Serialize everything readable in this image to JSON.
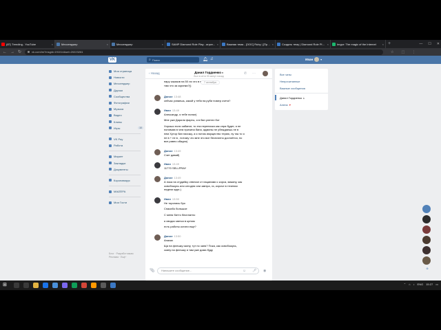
{
  "browser": {
    "tabs": [
      {
        "label": "(87) Trending - YouTube",
        "color": "#ff0000"
      },
      {
        "label": "Мессенджер",
        "color": "#4a76a8",
        "active": true
      },
      {
        "label": "Мессенджер",
        "color": "#4a76a8"
      },
      {
        "label": "SAMP Diamond Role Play - играт...",
        "color": "#3b78c4"
      },
      {
        "label": "Важная тема - [OOC] Ruby | [Про...",
        "color": "#3b78c4"
      },
      {
        "label": "Создать тему | Diamond Role Play...",
        "color": "#3b78c4"
      },
      {
        "label": "Imgur: The magic of the Internet",
        "color": "#1bb76e"
      }
    ],
    "new_tab": "+",
    "close_glyph": "×",
    "url": "vk.com/im?msgid=191014&sel=20223261"
  },
  "vk": {
    "logo": "VK",
    "search_placeholder": "Поиск",
    "user_name": "Иван",
    "menu": [
      {
        "label": "Моя страница"
      },
      {
        "label": "Новости"
      },
      {
        "label": "Мессенджер"
      },
      {
        "label": "Друзья"
      },
      {
        "label": "Сообщества"
      },
      {
        "label": "Фотографии"
      },
      {
        "label": "Музыка"
      },
      {
        "label": "Видео"
      },
      {
        "label": "Клипы"
      },
      {
        "label": "Игры",
        "count": "10"
      }
    ],
    "menu2": [
      {
        "label": "VK Pay"
      },
      {
        "label": "Работа"
      }
    ],
    "menu3": [
      {
        "label": "Маркет"
      },
      {
        "label": "Закладки"
      },
      {
        "label": "Документы"
      }
    ],
    "menu4": [
      {
        "label": "Коронавирус"
      }
    ],
    "menu5": [
      {
        "label": "MAIZEPA"
      }
    ],
    "menu6": [
      {
        "label": "Мои Гости"
      }
    ],
    "footer": [
      "Блог · Разработчикам",
      "Реклама · Ещё ·"
    ]
  },
  "chat": {
    "back_label": "Назад",
    "peer_name": "Данил Гордиенко",
    "peer_status": "был в сети 30 минут назад",
    "date_pill": "7 сентября",
    "top_lines": [
      "пару заказов на 50 ли что в все",
      "там что за скрипки?))"
    ],
    "messages": [
      {
        "author": "Данил",
        "time": "13:48",
        "lines": [
          "сейчас узнаешь, какой у тебя на руби номер счета?"
        ],
        "avatar_color": "#6f5e55"
      },
      {
        "author": "Иван",
        "time": "13:49",
        "lines": [
          "Александр, я тебе понял)",
          "",
          "Мне уже Дарили фарты, я в бан улетел бот",
          "",
          "Хорошо если забанят, то эта переписка как спра будет, я не",
          "понимаю в чем причина бана, админы не убеждаешь не в",
          "нем Хутор бан нахожу, а я потом имущество теряю, ну так то я",
          "не в + не в , потому что мне это все бесплатно достаётся, но",
          "все равно обидно)"
        ],
        "avatar_color": "#3b3a3f"
      },
      {
        "author": "Данил",
        "time": "13:49",
        "lines": [
          "Счет давай)"
        ],
        "avatar_color": "#6f5e55"
      },
      {
        "author": "Иван",
        "time": "13:49",
        "lines": [
          "11770 SELLPRAY"
        ],
        "avatar_color": "#3b3a3f"
      },
      {
        "author": "Данил",
        "time": "13:49",
        "lines": [
          "А пока на студийку отвехал от пацанами с корса, макину, как",
          "освобожусь или сегодня или завтра, хз, короче в течении",
          "недели ждю )"
        ],
        "avatar_color": "#6f5e55"
      },
      {
        "author": "Иван",
        "time": "13:50",
        "lines": [
          "Не торопись бро",
          "",
          "Спасибо большое",
          "",
          "С меня битто бесплатно",
          "",
          "я свидос минса в целом",
          "",
          "есть работы кстати еще?"
        ],
        "avatar_color": "#3b3a3f"
      },
      {
        "author": "Данил",
        "time": "13:50",
        "lines": [
          "Анахах",
          "",
          "Ща на флешку скину, тут по заня? Пока, как освобожусь,",
          "скину на флешку и там уже дома буду"
        ],
        "avatar_color": "#6f5e55"
      }
    ],
    "composer_placeholder": "Напишите сообщение..."
  },
  "filters": {
    "items": [
      "Все чаты",
      "Непрочитанные",
      "Важные сообщения"
    ],
    "folders": [
      "Данил Гордиенко",
      "Алена"
    ]
  },
  "taskbar": {
    "lang": "ENG",
    "time": "15:27"
  }
}
